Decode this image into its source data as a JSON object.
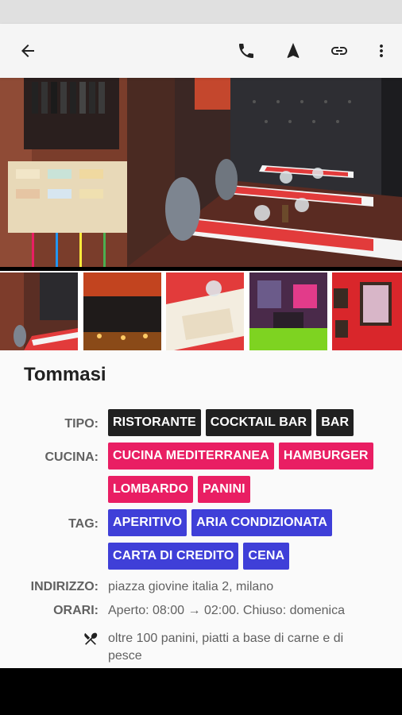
{
  "restaurant": {
    "name": "Tommasi"
  },
  "details": {
    "tipo_label": "TIPO:",
    "tipo": [
      "RISTORANTE",
      "COCKTAIL BAR",
      "BAR"
    ],
    "cucina_label": "CUCINA:",
    "cucina": [
      "CUCINA MEDITERRANEA",
      "HAMBURGER",
      "LOMBARDO",
      "PANINI"
    ],
    "tag_label": "TAG:",
    "tags": [
      "APERITIVO",
      "ARIA CONDIZIONATA",
      "CARTA DI CREDITO",
      "CENA"
    ],
    "indirizzo_label": "INDIRIZZO:",
    "indirizzo": "piazza giovine italia 2, milano",
    "orari_label": "ORARI:",
    "orari": "Aperto: 08:00 → 02:00. Chiuso: domenica",
    "description": "oltre 100 panini, piatti a base di carne e di pesce"
  },
  "toolbar": {
    "back_icon": "arrow-back-icon",
    "phone_icon": "phone-icon",
    "navigate_icon": "navigation-arrow-icon",
    "link_icon": "link-icon",
    "more_icon": "more-vert-icon"
  },
  "colors": {
    "tipo_chip": "#212121",
    "cucina_chip": "#e91e63",
    "tag_chip": "#3f3fd8"
  }
}
